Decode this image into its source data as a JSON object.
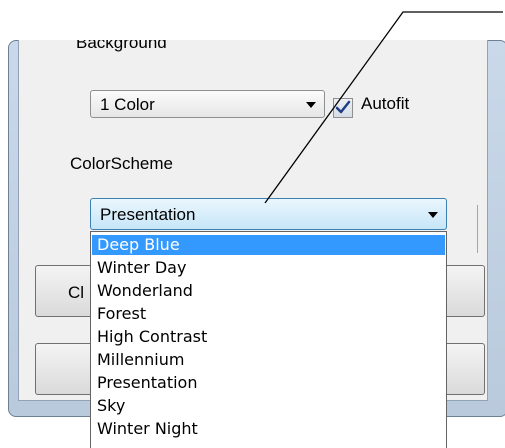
{
  "background_group": {
    "label": "Background"
  },
  "background_select": {
    "value": "1 Color"
  },
  "autofit": {
    "label": "Autofit",
    "checked": true
  },
  "color_scheme": {
    "label": "ColorScheme",
    "value": "Presentation",
    "options": [
      "Deep Blue",
      "Winter Day",
      "Wonderland",
      "Forest",
      "High Contrast",
      "Millennium",
      "Presentation",
      "Sky",
      "Winter Night"
    ],
    "highlighted": "Deep Blue"
  },
  "partial_button": {
    "label": "Cl"
  },
  "icons": {
    "check": "checkmark-icon",
    "dropdown": "chevron-down-icon"
  }
}
